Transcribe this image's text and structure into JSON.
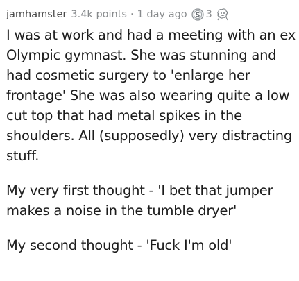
{
  "comment": {
    "username": "jamhamster",
    "points": "3.4k points",
    "separator": "·",
    "time": "1 day ago",
    "awards": [
      {
        "icon": "silver-award-icon",
        "count": "3"
      },
      {
        "icon": "helpful-award-icon"
      }
    ],
    "paragraphs": [
      "I was at work and had a meeting with an ex Olympic gymnast. She was stunning and had cosmetic surgery to 'enlarge her frontage' She was also wearing quite a low cut top that had metal spikes in the shoulders. All (supposedly) very distracting stuff.",
      "My very first thought - 'I bet that jumper makes a noise in the tumble dryer'",
      "My second thought - 'Fuck I'm old'"
    ]
  }
}
